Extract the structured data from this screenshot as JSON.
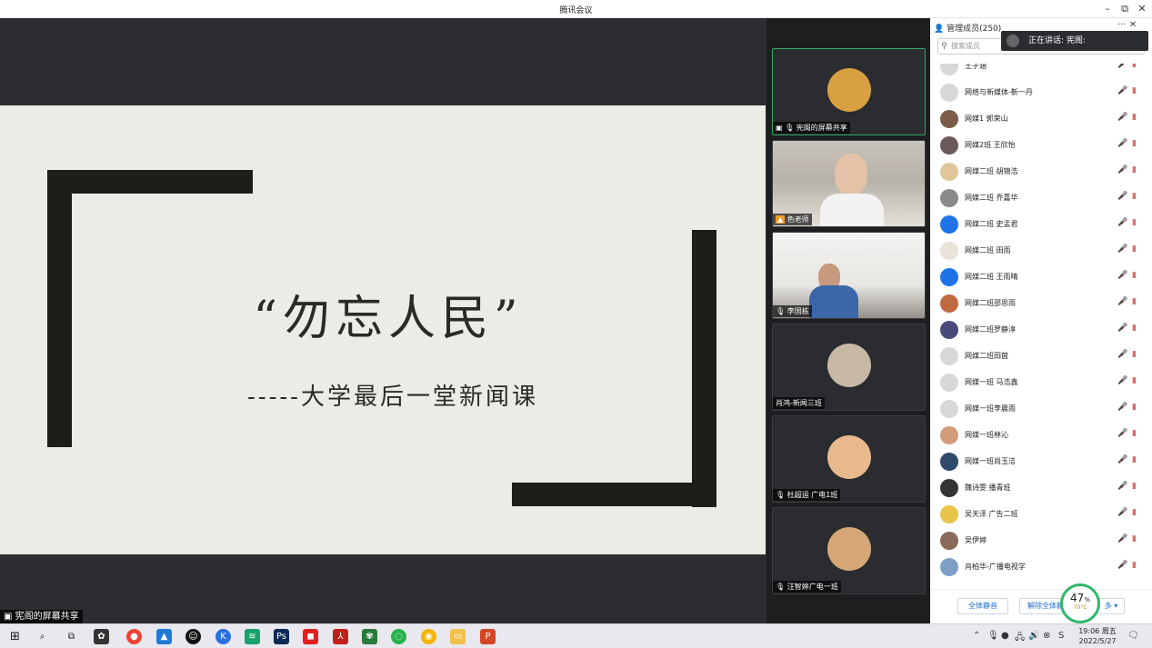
{
  "window": {
    "title": "腾讯会议",
    "minimize": "–",
    "restore": "⧉",
    "close": "✕"
  },
  "slide": {
    "title": "“勿忘人民”",
    "subtitle": "-----大学最后一堂新闻课"
  },
  "share_label": "宪阁的屏幕共享",
  "video_tiles": [
    {
      "label": "宪阁的屏幕共享",
      "type": "avatar",
      "active": true
    },
    {
      "label": "色老师",
      "type": "camera"
    },
    {
      "label": "李国栋",
      "type": "camera"
    },
    {
      "label": "肖鸿-新闻三班",
      "type": "avatar"
    },
    {
      "label": "杜超运 广电1班",
      "type": "avatar"
    },
    {
      "label": "汪智婷广电一班",
      "type": "avatar"
    }
  ],
  "panel": {
    "header": "管理成员(250)",
    "more": "··· ✕",
    "search_placeholder": "搜索成员",
    "speaking": "正在讲话: 宪阁:",
    "members": [
      {
        "name": "王子涵",
        "avatar": "#d8d8d8"
      },
      {
        "name": "网络与新媒体-靳一丹",
        "avatar": "#d8d8d8"
      },
      {
        "name": "网媒1 郭荣山",
        "avatar": "#7a5c48"
      },
      {
        "name": "网媒2班 王欣怡",
        "avatar": "#6a5a5a"
      },
      {
        "name": "网媒二班 胡锦浩",
        "avatar": "#e0c79a"
      },
      {
        "name": "网媒二班 乔嘉华",
        "avatar": "#8a8a8a"
      },
      {
        "name": "网媒二班 史孟君",
        "avatar": "#1e74e6"
      },
      {
        "name": "网媒二班 田雨",
        "avatar": "#e9e2d8"
      },
      {
        "name": "网媒二班 王雨晴",
        "avatar": "#1e74e6"
      },
      {
        "name": "网媒二班邵思雨",
        "avatar": "#c06a40"
      },
      {
        "name": "网媒二班罗静淳",
        "avatar": "#4a4a7a"
      },
      {
        "name": "网媒二班田茵",
        "avatar": "#d8d8d8"
      },
      {
        "name": "网媒一班 马浩鑫",
        "avatar": "#d8d8d8"
      },
      {
        "name": "网媒一班李晨雨",
        "avatar": "#d8d8d8"
      },
      {
        "name": "网媒一班林沁",
        "avatar": "#d29b7a"
      },
      {
        "name": "网媒一班尚玉洁",
        "avatar": "#2f4a6a"
      },
      {
        "name": "魏诗雯 播青班",
        "avatar": "#333333"
      },
      {
        "name": "吴天泽 广告二班",
        "avatar": "#e8c44a"
      },
      {
        "name": "吴伊婷",
        "avatar": "#8a6a5a"
      },
      {
        "name": "肖柏华-广播电视学",
        "avatar": "#7f9fc6"
      }
    ],
    "mic_icon": "🎤̸",
    "cam_icon": "▮",
    "mute_all": "全体静音",
    "unmute_all": "解除全体静音",
    "more_btn": "多 ▾"
  },
  "gauge": {
    "value": "47",
    "unit": "%",
    "temp": "70°C"
  },
  "taskbar": {
    "clock_time": "19:06 周五",
    "clock_date": "2022/5/27"
  },
  "colors": {
    "active_border": "#2fa864",
    "link_blue": "#1f6fd0"
  }
}
